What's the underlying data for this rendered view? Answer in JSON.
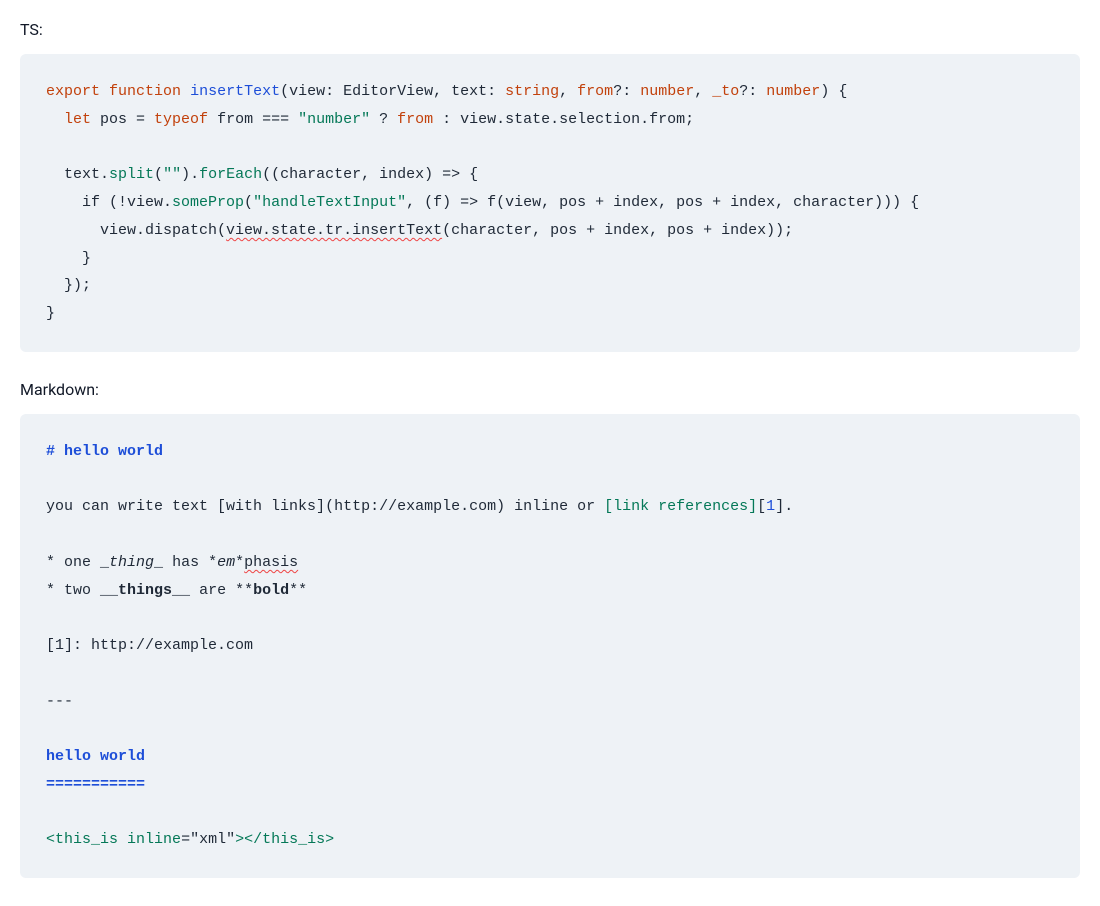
{
  "labels": {
    "ts": "TS:",
    "markdown": "Markdown:"
  },
  "ts": {
    "l1": {
      "export": "export",
      "function": "function",
      "fname": "insertText",
      "lp": "(",
      "p1": "view: EditorView, text: ",
      "t1": "string",
      "c1": ", ",
      "p2": "from",
      "q1": "?:",
      "sp1": " ",
      "t2": "number",
      "c2": ", ",
      "p3": "_to",
      "q2": "?:",
      "sp2": " ",
      "t3": "number",
      "rp": ") {"
    },
    "l2": {
      "ind": "  ",
      "let": "let",
      "sp": " pos = ",
      "typeof": "typeof",
      "sp2": " from === ",
      "str": "\"number\"",
      "sp3": " ? ",
      "from": "from",
      "sp4": " : view.state.selection.from;"
    },
    "l3": {
      "ind": "  text.",
      "m1": "split",
      "lp": "(",
      "str": "\"\"",
      "rp": ").",
      "m2": "forEach",
      "rest": "((character, index) => {"
    },
    "l4": {
      "ind": "    if (!view.",
      "m1": "someProp",
      "lp": "(",
      "str": "\"handleTextInput\"",
      "rest": ", (f) => f(view, pos + index, pos + index, character))) {"
    },
    "l5": {
      "ind": "      view.dispatch(",
      "err": "view.state.tr.insertText",
      "rest": "(character, pos + index, pos + index));"
    },
    "l6": "    }",
    "l7": "  });",
    "l8": "}"
  },
  "md": {
    "h1": "# hello world",
    "p1a": "you can write text ",
    "p1b": "[with links]",
    "p1c": "(http://example.com)",
    "p1d": " inline or ",
    "p1e": "[link references]",
    "p1f": "[",
    "p1g": "1",
    "p1h": "].",
    "li1a": "* one ",
    "li1b": "_",
    "li1c": "thing",
    "li1d": "_",
    "li1e": " has ",
    "li1f": "*",
    "li1g": "em",
    "li1h": "*",
    "li1i": "phasis",
    "li2a": "* two ",
    "li2b": "__",
    "li2c": "things",
    "li2d": "__",
    "li2e": " are ",
    "li2f": "**",
    "li2g": "bold",
    "li2h": "**",
    "ref": "[1]: http://example.com",
    "hr": "---",
    "h2a": "hello world",
    "h2b": "===========",
    "x1": "<",
    "x2": "this_is",
    "x3": " ",
    "x4": "inline",
    "x5": "=",
    "x6": "\"xml\"",
    "x7": "></",
    "x8": "this_is",
    "x9": ">"
  }
}
